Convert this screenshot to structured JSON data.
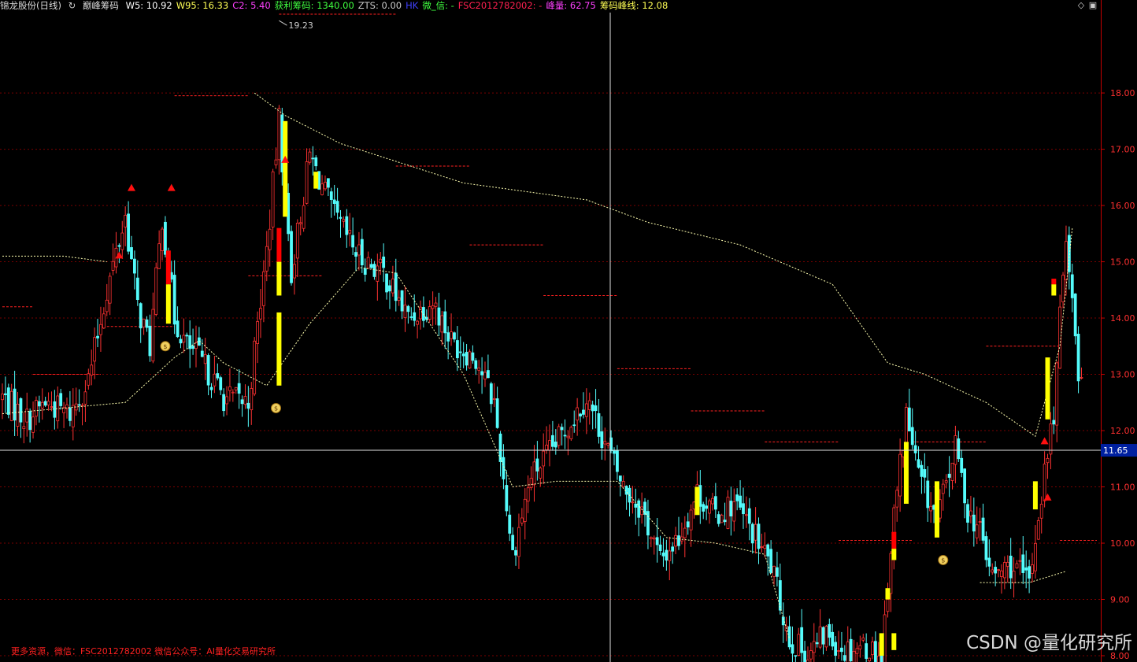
{
  "header": {
    "stock": "锦龙股份(日线)",
    "indicator_icon": "circle-arrow-icon",
    "indicator": "巅峰筹码",
    "items": [
      {
        "label": "W5:",
        "value": "10.92",
        "color": "#ffffff"
      },
      {
        "label": "W95:",
        "value": "16.33",
        "color": "#ffff55"
      },
      {
        "label": "C2:",
        "value": "5.40",
        "color": "#ff40ff"
      },
      {
        "label": "获利筹码:",
        "value": "1340.00",
        "color": "#40ff40"
      },
      {
        "label": "ZTS:",
        "value": "0.00",
        "color": "#c8c8c8"
      },
      {
        "label": "HK",
        "value": "",
        "color": "#4040ff"
      },
      {
        "label": "微_信:",
        "value": "-",
        "color": "#40ff40"
      },
      {
        "label": "FSC2012782002:",
        "value": "-",
        "color": "#ff2050"
      },
      {
        "label": "峰量:",
        "value": "62.75",
        "color": "#ff40ff"
      },
      {
        "label": "筹码峰线:",
        "value": "12.08",
        "color": "#ffff55"
      }
    ]
  },
  "window_buttons": {
    "diamond": "◇",
    "toggle": "▣"
  },
  "footer": {
    "text": "更多资源，微信：FSC2012782002 微信公众号：AI量化交易研究所"
  },
  "watermark": "CSDN @量化研究所",
  "colors": {
    "up": "#ff3232",
    "down": "#54fcfc",
    "signal_yellow": "#ffff00",
    "signal_red": "#ff0000",
    "axis": "#c80000",
    "dash": "#ff2020",
    "curve": "#ffffb0"
  },
  "chart_data": {
    "type": "candlestick",
    "y_axis": {
      "min": 8.0,
      "max": 19.4,
      "ticks": [
        "8.00",
        "9.00",
        "10.00",
        "11.00",
        "12.00",
        "13.00",
        "14.00",
        "15.00",
        "16.00",
        "17.00",
        "18.00"
      ]
    },
    "crosshair": {
      "price": "11.65"
    },
    "annotations": [
      {
        "text": "19.23",
        "price": 19.23
      }
    ],
    "anchors": [
      {
        "i": 0,
        "c": 12.6
      },
      {
        "i": 8,
        "c": 12.2
      },
      {
        "i": 14,
        "c": 12.5
      },
      {
        "i": 22,
        "c": 12.3
      },
      {
        "i": 28,
        "c": 12.9
      },
      {
        "i": 34,
        "c": 14.5
      },
      {
        "i": 40,
        "c": 15.8
      },
      {
        "i": 44,
        "c": 14.2
      },
      {
        "i": 48,
        "c": 13.5
      },
      {
        "i": 52,
        "c": 15.8
      },
      {
        "i": 56,
        "c": 14.0
      },
      {
        "i": 60,
        "c": 13.5
      },
      {
        "i": 64,
        "c": 13.3
      },
      {
        "i": 72,
        "c": 12.6
      },
      {
        "i": 80,
        "c": 12.5
      },
      {
        "i": 86,
        "c": 15.2
      },
      {
        "i": 90,
        "c": 17.5
      },
      {
        "i": 94,
        "c": 14.8
      },
      {
        "i": 100,
        "c": 16.9
      },
      {
        "i": 108,
        "c": 15.8
      },
      {
        "i": 116,
        "c": 15.1
      },
      {
        "i": 124,
        "c": 14.8
      },
      {
        "i": 132,
        "c": 14.0
      },
      {
        "i": 140,
        "c": 14.3
      },
      {
        "i": 146,
        "c": 13.6
      },
      {
        "i": 154,
        "c": 13.3
      },
      {
        "i": 160,
        "c": 12.5
      },
      {
        "i": 166,
        "c": 9.8
      },
      {
        "i": 172,
        "c": 11.2
      },
      {
        "i": 178,
        "c": 11.6
      },
      {
        "i": 184,
        "c": 12.1
      },
      {
        "i": 190,
        "c": 12.6
      },
      {
        "i": 196,
        "c": 11.8
      },
      {
        "i": 202,
        "c": 11.0
      },
      {
        "i": 208,
        "c": 10.6
      },
      {
        "i": 214,
        "c": 9.7
      },
      {
        "i": 220,
        "c": 10.1
      },
      {
        "i": 226,
        "c": 10.9
      },
      {
        "i": 232,
        "c": 10.5
      },
      {
        "i": 238,
        "c": 10.7
      },
      {
        "i": 244,
        "c": 10.2
      },
      {
        "i": 250,
        "c": 9.6
      },
      {
        "i": 256,
        "c": 8.3
      },
      {
        "i": 262,
        "c": 8.0
      },
      {
        "i": 268,
        "c": 8.4
      },
      {
        "i": 274,
        "c": 8.1
      },
      {
        "i": 280,
        "c": 8.2
      },
      {
        "i": 286,
        "c": 8.0
      },
      {
        "i": 290,
        "c": 10.5
      },
      {
        "i": 294,
        "c": 12.3
      },
      {
        "i": 298,
        "c": 11.2
      },
      {
        "i": 304,
        "c": 10.4
      },
      {
        "i": 310,
        "c": 11.7
      },
      {
        "i": 314,
        "c": 10.6
      },
      {
        "i": 318,
        "c": 10.2
      },
      {
        "i": 322,
        "c": 9.4
      },
      {
        "i": 328,
        "c": 9.6
      },
      {
        "i": 334,
        "c": 9.3
      },
      {
        "i": 338,
        "c": 10.9
      },
      {
        "i": 342,
        "c": 12.3
      },
      {
        "i": 346,
        "c": 15.6
      },
      {
        "i": 350,
        "c": 13.0
      }
    ],
    "cost_curve_upper": [
      {
        "i": 82,
        "c": 18.0
      },
      {
        "i": 92,
        "c": 17.6
      },
      {
        "i": 110,
        "c": 17.1
      },
      {
        "i": 150,
        "c": 16.4
      },
      {
        "i": 190,
        "c": 16.1
      },
      {
        "i": 210,
        "c": 15.7
      },
      {
        "i": 240,
        "c": 15.3
      },
      {
        "i": 270,
        "c": 14.6
      },
      {
        "i": 288,
        "c": 13.2
      },
      {
        "i": 300,
        "c": 13.0
      },
      {
        "i": 320,
        "c": 12.5
      },
      {
        "i": 336,
        "c": 11.9
      },
      {
        "i": 344,
        "c": 13.5
      },
      {
        "i": 348,
        "c": 15.6
      }
    ],
    "cost_curve_lower": [
      {
        "i": 0,
        "c": 12.3
      },
      {
        "i": 20,
        "c": 12.4
      },
      {
        "i": 40,
        "c": 12.5
      },
      {
        "i": 56,
        "c": 13.3
      },
      {
        "i": 64,
        "c": 13.6
      },
      {
        "i": 72,
        "c": 13.2
      },
      {
        "i": 86,
        "c": 12.8
      },
      {
        "i": 100,
        "c": 13.9
      },
      {
        "i": 116,
        "c": 14.9
      },
      {
        "i": 128,
        "c": 14.8
      },
      {
        "i": 150,
        "c": 13.0
      },
      {
        "i": 166,
        "c": 11.0
      },
      {
        "i": 180,
        "c": 11.1
      },
      {
        "i": 200,
        "c": 11.1
      },
      {
        "i": 216,
        "c": 10.1
      },
      {
        "i": 232,
        "c": 10.0
      },
      {
        "i": 248,
        "c": 9.8
      },
      {
        "i": 256,
        "c": 8.3
      }
    ],
    "cost_curve_left": [
      {
        "i": 0,
        "c": 15.1
      },
      {
        "i": 20,
        "c": 15.1
      },
      {
        "i": 34,
        "c": 15.0
      }
    ],
    "cost_curve_right": [
      {
        "i": 318,
        "c": 9.3
      },
      {
        "i": 334,
        "c": 9.3
      },
      {
        "i": 346,
        "c": 9.5
      }
    ],
    "resistance_levels": [
      {
        "from": 0,
        "to": 10,
        "price": 14.2
      },
      {
        "from": 10,
        "to": 32,
        "price": 13.0
      },
      {
        "from": 34,
        "to": 56,
        "price": 13.85
      },
      {
        "from": 56,
        "to": 80,
        "price": 17.95
      },
      {
        "from": 80,
        "to": 104,
        "price": 14.75
      },
      {
        "from": 90,
        "to": 128,
        "price": 19.4
      },
      {
        "from": 128,
        "to": 152,
        "price": 16.7
      },
      {
        "from": 152,
        "to": 176,
        "price": 15.3
      },
      {
        "from": 176,
        "to": 200,
        "price": 14.4
      },
      {
        "from": 200,
        "to": 224,
        "price": 13.1
      },
      {
        "from": 224,
        "to": 248,
        "price": 12.35
      },
      {
        "from": 248,
        "to": 272,
        "price": 11.8
      },
      {
        "from": 272,
        "to": 296,
        "price": 10.05
      },
      {
        "from": 296,
        "to": 320,
        "price": 11.8
      },
      {
        "from": 320,
        "to": 344,
        "price": 13.5
      },
      {
        "from": 344,
        "to": 356,
        "price": 10.05
      }
    ],
    "signal_bars": [
      {
        "i": 54,
        "low": 13.9,
        "high": 14.6,
        "color": "yellow"
      },
      {
        "i": 54,
        "low": 14.6,
        "high": 15.2,
        "color": "red"
      },
      {
        "i": 90,
        "low": 12.8,
        "high": 14.1,
        "color": "yellow"
      },
      {
        "i": 90,
        "low": 14.4,
        "high": 15.0,
        "color": "yellow"
      },
      {
        "i": 90,
        "low": 15.0,
        "high": 15.6,
        "color": "red"
      },
      {
        "i": 92,
        "low": 15.8,
        "high": 17.5,
        "color": "yellow"
      },
      {
        "i": 102,
        "low": 16.3,
        "high": 16.6,
        "color": "yellow"
      },
      {
        "i": 226,
        "low": 10.5,
        "high": 11.0,
        "color": "yellow"
      },
      {
        "i": 286,
        "low": 8.0,
        "high": 8.4,
        "color": "yellow"
      },
      {
        "i": 288,
        "low": 9.0,
        "high": 9.2,
        "color": "yellow"
      },
      {
        "i": 290,
        "low": 8.1,
        "high": 8.4,
        "color": "yellow"
      },
      {
        "i": 290,
        "low": 9.9,
        "high": 10.2,
        "color": "red"
      },
      {
        "i": 290,
        "low": 9.7,
        "high": 9.9,
        "color": "yellow"
      },
      {
        "i": 294,
        "low": 10.7,
        "high": 11.8,
        "color": "yellow"
      },
      {
        "i": 304,
        "low": 10.1,
        "high": 11.1,
        "color": "yellow"
      },
      {
        "i": 336,
        "low": 10.6,
        "high": 11.1,
        "color": "yellow"
      },
      {
        "i": 340,
        "low": 12.2,
        "high": 13.3,
        "color": "yellow"
      },
      {
        "i": 342,
        "low": 14.4,
        "high": 14.6,
        "color": "yellow"
      },
      {
        "i": 342,
        "low": 14.6,
        "high": 14.7,
        "color": "red"
      }
    ],
    "up_arrows": [
      {
        "i": 38,
        "price": 15.1
      },
      {
        "i": 42,
        "price": 16.3
      },
      {
        "i": 55,
        "price": 16.3
      },
      {
        "i": 92,
        "price": 16.8
      },
      {
        "i": 339,
        "price": 11.8
      },
      {
        "i": 340,
        "price": 10.8
      }
    ],
    "moneybags": [
      {
        "i": 53,
        "price": 13.5
      },
      {
        "i": 89,
        "price": 12.4
      },
      {
        "i": 306,
        "price": 9.7
      }
    ]
  }
}
